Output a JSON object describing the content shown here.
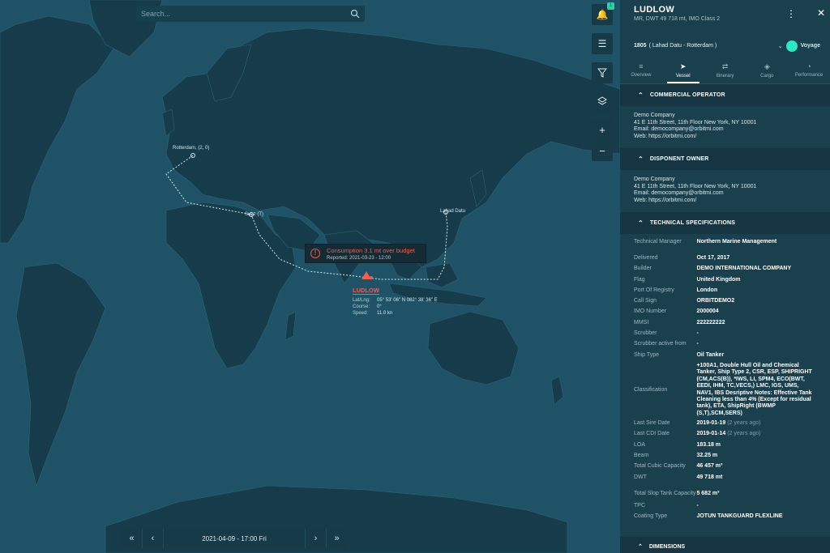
{
  "search": {
    "placeholder": "Search..."
  },
  "notifications": {
    "count": "1"
  },
  "map": {
    "ports": [
      "Rotterdam, (2, 0)",
      "Suez (T)",
      "Lahad Datu"
    ],
    "alert": {
      "title": "Consumption 3.1 mt over budget",
      "reported": "Reported: 2021-03-23 - 12:00"
    },
    "vessel": {
      "name": "LUDLOW",
      "latlng_label": "Lat/Lng:",
      "latlng": "05° 53' 06\" N 082° 38' 36\" E",
      "course_label": "Course:",
      "course": "0°",
      "speed_label": "Speed:",
      "speed": "11.0 kn"
    },
    "timebar": {
      "date": "2021-04-09 - 17:00 Fri"
    }
  },
  "panel": {
    "title": "LUDLOW",
    "subtitle": "MR, DWT 49 718 mt, IMO Class 2",
    "voyage": {
      "id": "1805",
      "route": "( Lahad Datu - Rotterdam )",
      "toggle_label": "Voyage"
    },
    "tabs": [
      {
        "label": "Overview",
        "icon": "overview-icon"
      },
      {
        "label": "Vessel",
        "icon": "navigation-arrow-icon"
      },
      {
        "label": "Itinerary",
        "icon": "itinerary-icon"
      },
      {
        "label": "Cargo",
        "icon": "cargo-box-icon"
      },
      {
        "label": "Performance",
        "icon": "gauge-icon"
      }
    ],
    "commercial_operator": {
      "heading": "COMMERCIAL OPERATOR",
      "name": "Demo Company",
      "address": "41 E 11th Street, 11th Floor New York, NY 10001",
      "email": "Email: democompany@orbitmi.com",
      "web": "Web: https://orbitmi.com/"
    },
    "disponent_owner": {
      "heading": "DISPONENT OWNER",
      "name": "Demo Company",
      "address": "41 E 11th Street, 11th Floor New York, NY 10001",
      "email": "Email: democompany@orbitmi.com",
      "web": "Web: https://orbitmi.com/"
    },
    "technical": {
      "heading": "TECHNICAL SPECIFICATIONS",
      "manager_label": "Technical Manager",
      "manager": "Northern Marine Management",
      "rows": [
        {
          "k": "Delivered",
          "v": "Oct 17, 2017"
        },
        {
          "k": "Builder",
          "v": "DEMO INTERNATIONAL COMPANY"
        },
        {
          "k": "Flag",
          "v": "United Kingdom"
        },
        {
          "k": "Port Of Registry",
          "v": "London"
        },
        {
          "k": "Call Sign",
          "v": "ORBITDEMO2"
        },
        {
          "k": "IMO Number",
          "v": "2000004"
        },
        {
          "k": "MMSI",
          "v": "222222222"
        },
        {
          "k": "Scrubber",
          "v": "-"
        },
        {
          "k": "Scrubber active from",
          "v": "-"
        },
        {
          "k": "Ship Type",
          "v": "Oil Tanker"
        }
      ],
      "classification_label": "Classification",
      "classification": "+100A1, Double Hull Oil and Chemical Tanker, Ship Type 2, CSR, ESP, SHIPRIGHT (CM,ACS(B)), *IWS, LI, SPM4, ECO(BWT, EEDI, IHM, TC,VECS,) LMC, IGS, UMS, NAV1, IBS Desriptive Notes: Effective Tank Cleaning less than 4% (Except for residual tank), ETA, ShipRight (BWMP (S,T),SCM,SERS)",
      "last_sire_label": "Last Sire Date",
      "last_sire": "2019-01-19",
      "last_sire_age": "(2 years ago)",
      "last_cdi_label": "Last CDI Date",
      "last_cdi": "2019-01-14",
      "last_cdi_age": "(2 years ago)",
      "rows2": [
        {
          "k": "LOA",
          "v": "183.18 m"
        },
        {
          "k": "Beam",
          "v": "32.25 m"
        },
        {
          "k": "Total Cubic Capacity",
          "v": "46 457 m³"
        },
        {
          "k": "DWT",
          "v": "49 718 mt"
        }
      ],
      "slop_label": "Total Slop Tank Capacity",
      "slop": "5 682 m³",
      "tpc_label": "TPC",
      "tpc": "-",
      "coating_label": "Coating Type",
      "coating": "JOTUN TANKGUARD FLEXLINE"
    },
    "dimensions": {
      "heading": "DIMENSIONS"
    }
  }
}
